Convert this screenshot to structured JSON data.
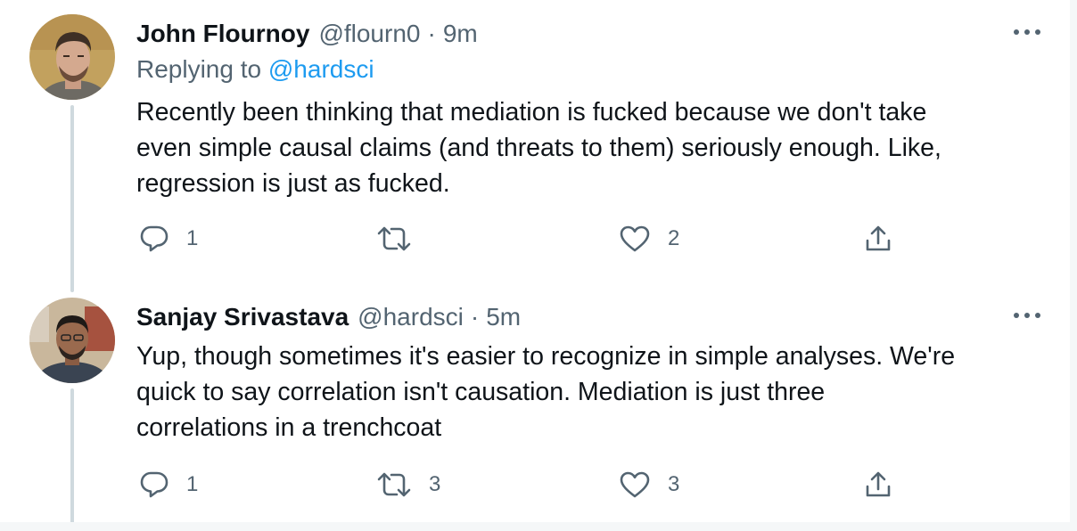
{
  "tweets": [
    {
      "author": {
        "display_name": "John Flournoy",
        "handle": "@flourn0",
        "avatar_icon": "avatar-john-photo"
      },
      "separator": "·",
      "time": "9m",
      "replying_prefix": "Replying to",
      "replying_to": "@hardsci",
      "body_lines": [
        "Recently been thinking that mediation is fucked because we don't take",
        "even simple causal claims (and threats to them) seriously enough. Like,",
        "regression is just as fucked."
      ],
      "actions": {
        "reply_count": "1",
        "retweet_count": "",
        "like_count": "2"
      }
    },
    {
      "author": {
        "display_name": "Sanjay Srivastava",
        "handle": "@hardsci",
        "avatar_icon": "avatar-sanjay-photo"
      },
      "separator": "·",
      "time": "5m",
      "body_lines": [
        "Yup, though sometimes it's easier to recognize in simple analyses. We're",
        "quick to say correlation isn't causation. Mediation is just three",
        "correlations in a trenchcoat"
      ],
      "actions": {
        "reply_count": "1",
        "retweet_count": "3",
        "like_count": "3"
      }
    }
  ],
  "icons": {
    "more": "more-horizontal-icon",
    "reply": "reply-icon",
    "retweet": "retweet-icon",
    "like": "heart-icon",
    "share": "share-icon"
  },
  "colors": {
    "text": "#0f1419",
    "secondary": "#536471",
    "link": "#1d9bf0",
    "thread_line": "#cfd9de"
  }
}
